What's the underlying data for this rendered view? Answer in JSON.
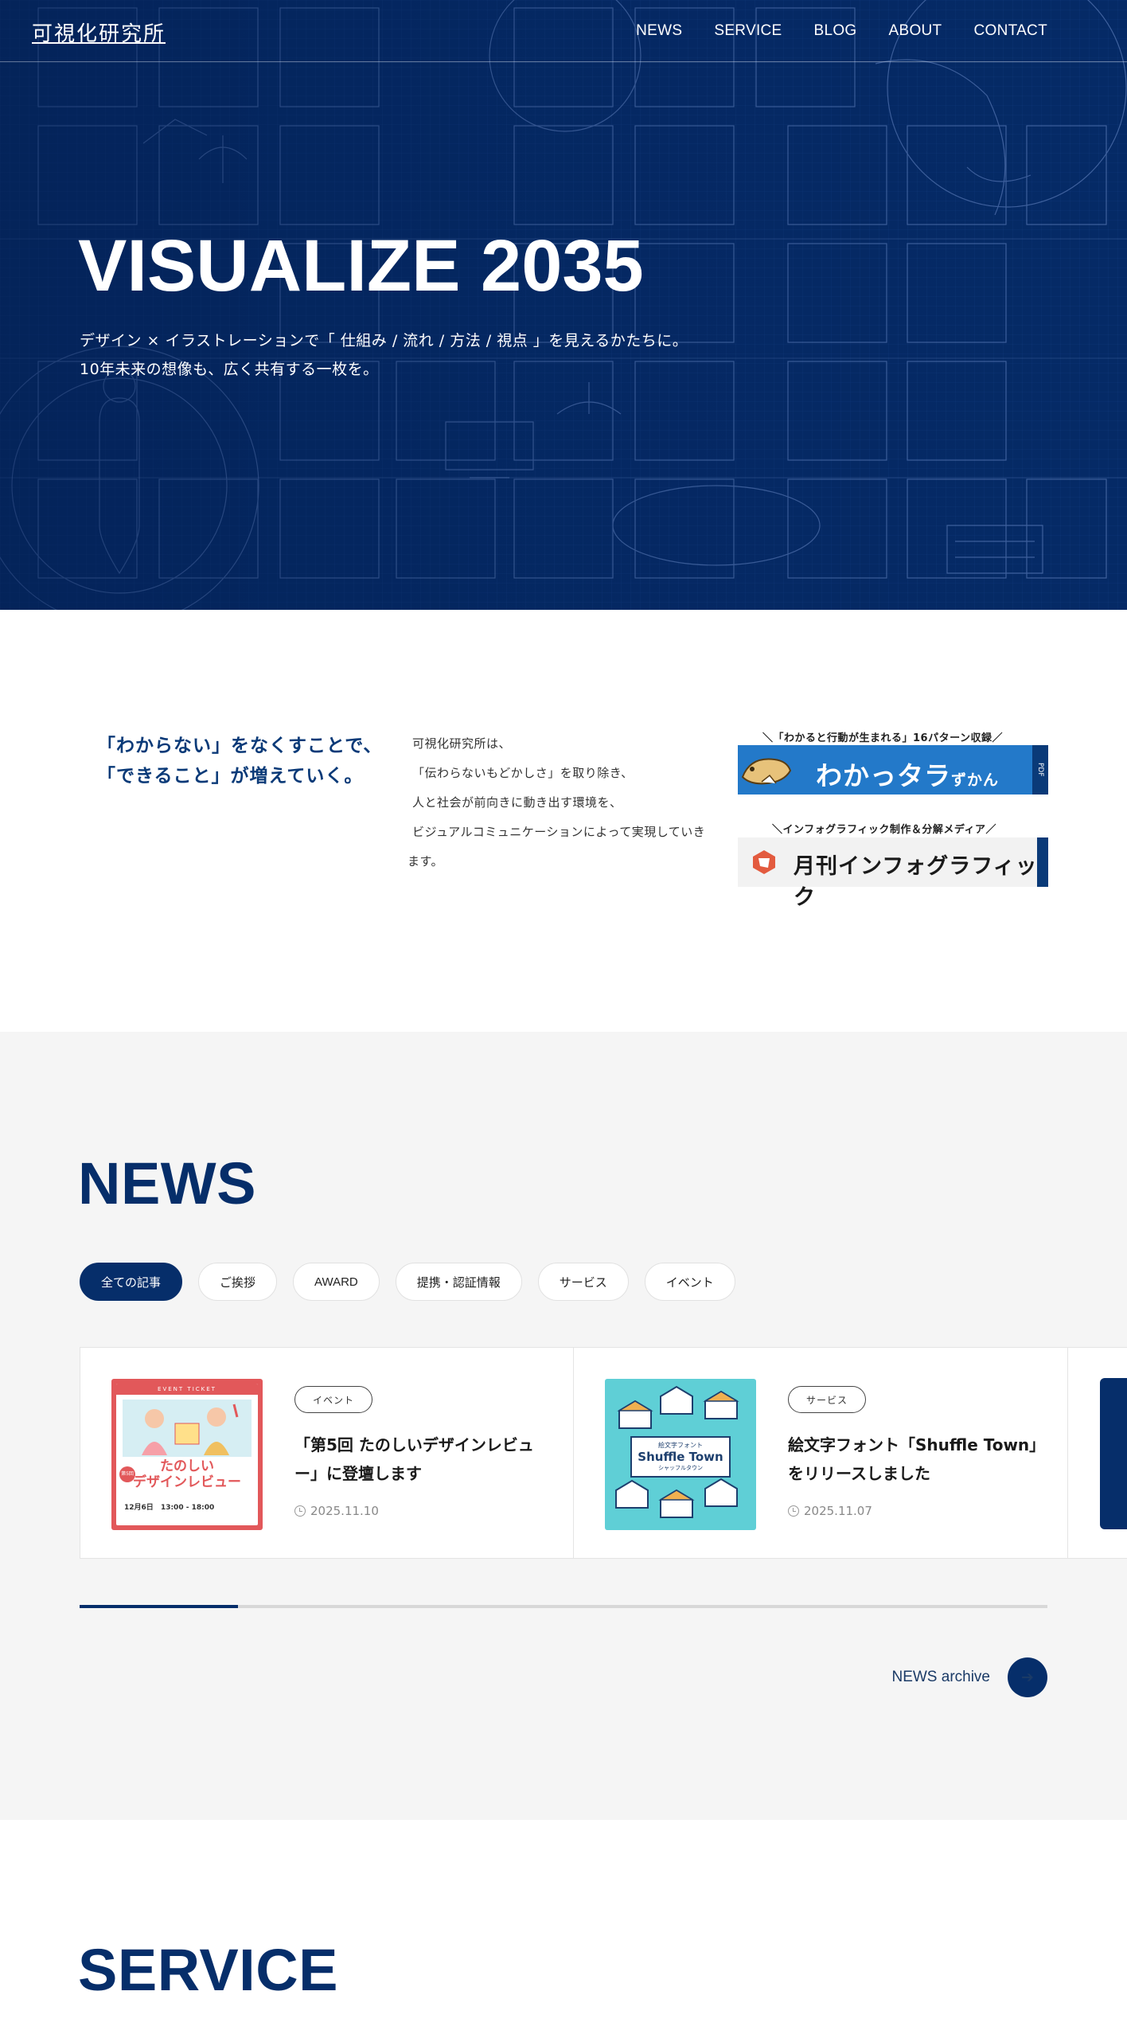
{
  "header": {
    "logo": "可視化研究所",
    "nav": [
      "NEWS",
      "SERVICE",
      "BLOG",
      "ABOUT",
      "CONTACT"
    ]
  },
  "hero": {
    "title": "VISUALIZE 2035",
    "subtitle_lines": [
      "デザイン × イラストレーションで「 仕組み / 流れ / 方法 / 視点 」を見えるかたちに。",
      "10年未来の想像も、広く共有する一枚を。"
    ]
  },
  "mission": {
    "tagline_lines": [
      "「わからない」をなくすことで、",
      "「できること」が増えていく。"
    ],
    "description_lines": [
      "可視化研究所は、",
      "「伝わらないもどかしさ」を取り除き、",
      "人と社会が前向きに動き出す環境を、",
      "ビジュアルコミュニケーションによって実現していき",
      "ます。"
    ],
    "banners": [
      {
        "caption": "「わかると行動が生まれる」16パターン収録",
        "text": "わかっタラ",
        "text_small": "ずかん",
        "tab": "PDF"
      },
      {
        "caption": "インフォグラフィック制作＆分解メディア",
        "text": "月刊インフォグラフィック"
      }
    ]
  },
  "news": {
    "title": "NEWS",
    "filters": [
      "全ての記事",
      "ご挨拶",
      "AWARD",
      "提携・認証情報",
      "サービス",
      "イベント"
    ],
    "active_filter": 0,
    "cards": [
      {
        "tag": "イベント",
        "title": "「第5回 たのしいデザインレビュー」に登壇します",
        "date": "2025.11.10"
      },
      {
        "tag": "サービス",
        "title": "絵文字フォント「Shuffle Town」をリリースしました",
        "date": "2025.11.07"
      }
    ],
    "thumb1": {
      "top": "EVENT TICKET",
      "title_a": "たのしい",
      "title_b": "デザインレビュー",
      "badge": "第5回",
      "date": "12月6日",
      "time": "13:00 - 18:00"
    },
    "thumb2": {
      "sub": "絵文字フォント",
      "title": "Shuffle Town",
      "kana": "シャッフルタウン"
    },
    "slider_progress": 0.164,
    "archive_label": "NEWS archive"
  },
  "service": {
    "title": "SERVICE"
  },
  "colors": {
    "navy": "#062e6a",
    "hero_bg": "#052a66",
    "accent_blue": "#2379c9",
    "news_bg": "#f5f5f5"
  }
}
